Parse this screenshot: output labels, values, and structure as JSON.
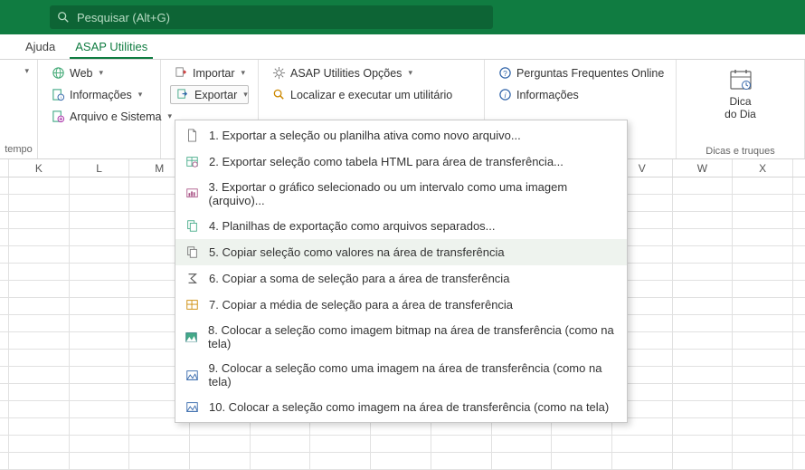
{
  "search": {
    "placeholder": "Pesquisar (Alt+G)"
  },
  "tabs": {
    "help": "Ajuda",
    "asap": "ASAP Utilities"
  },
  "ribbon": {
    "g0_label": "tempo",
    "g1": {
      "web": "Web",
      "info": "Informações",
      "arq": "Arquivo e Sistema"
    },
    "g2": {
      "importar": "Importar",
      "exportar": "Exportar"
    },
    "g3": {
      "opcoes": "ASAP Utilities Opções",
      "localizar": "Localizar e executar um utilitário"
    },
    "g4": {
      "faq": "Perguntas Frequentes Online",
      "info": "Informações"
    },
    "g5": {
      "dica1": "Dica",
      "dica2": "do Dia",
      "label": "Dicas e truques"
    }
  },
  "menu": [
    "1. Exportar a seleção ou planilha ativa como novo arquivo...",
    "2. Exportar seleção como tabela HTML para área de transferência...",
    "3. Exportar o gráfico selecionado ou um intervalo como uma imagem (arquivo)...",
    "4. Planilhas de exportação como arquivos separados...",
    "5. Copiar seleção como valores na área de transferência",
    "6. Copiar a soma de seleção para a área de transferência",
    "7. Copiar a média de seleção para a área de transferência",
    "8. Colocar a seleção como imagem bitmap na área de transferência (como na tela)",
    "9. Colocar a seleção como uma imagem na área de transferência (como na tela)",
    "10. Colocar a seleção como imagem na área de transferência (como na tela)"
  ],
  "cols": [
    "K",
    "L",
    "M",
    "",
    "",
    "",
    "",
    "",
    "",
    "",
    "V",
    "W",
    "X"
  ]
}
